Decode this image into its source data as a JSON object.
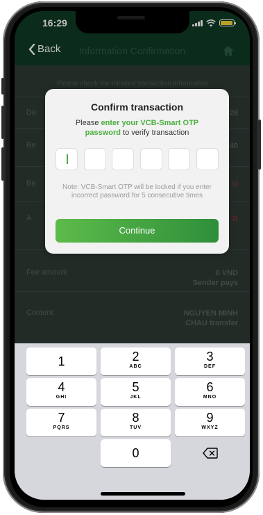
{
  "status": {
    "time": "16:29"
  },
  "nav": {
    "back_label": "Back",
    "title": "Information Confirmation"
  },
  "page": {
    "hint": "Please check the initiated transaction information",
    "rows": [
      {
        "label": "De",
        "value": "28",
        "red": false
      },
      {
        "label": "Be",
        "value": "40",
        "red": false
      },
      {
        "label": "Be",
        "value": "U",
        "red": true
      },
      {
        "label": "A",
        "value": "D",
        "red": true
      },
      {
        "label": "Fee amount",
        "value": "0 VND",
        "value2": "Sender pays",
        "red": false
      },
      {
        "label": "Content",
        "value": "NGUYEN MINH",
        "value2": "CHAU transfer",
        "red": false
      }
    ]
  },
  "modal": {
    "title": "Confirm transaction",
    "msg_prefix": "Please ",
    "msg_accent": "enter your VCB-Smart OTP password",
    "msg_suffix": " to verify transaction",
    "note": "Note: VCB-Smart OTP will be locked if you enter incorrect password for 5 consecutive times",
    "continue_label": "Continue"
  },
  "keyboard": {
    "keys": [
      {
        "num": "1",
        "letters": ""
      },
      {
        "num": "2",
        "letters": "ABC"
      },
      {
        "num": "3",
        "letters": "DEF"
      },
      {
        "num": "4",
        "letters": "GHI"
      },
      {
        "num": "5",
        "letters": "JKL"
      },
      {
        "num": "6",
        "letters": "MNO"
      },
      {
        "num": "7",
        "letters": "PQRS"
      },
      {
        "num": "8",
        "letters": "TUV"
      },
      {
        "num": "9",
        "letters": "WXYZ"
      },
      {
        "num": "0",
        "letters": ""
      }
    ],
    "delete_icon": "backspace-icon"
  },
  "colors": {
    "accent": "#4caf3f",
    "header": "#0f3a25"
  }
}
